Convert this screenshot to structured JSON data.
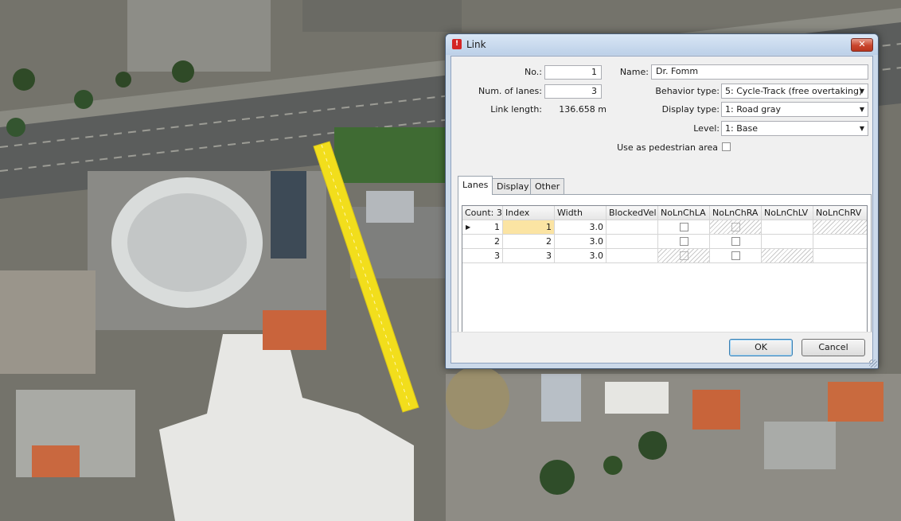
{
  "dialog": {
    "title": "Link",
    "close_glyph": "✕",
    "app_icon": "vissim-icon"
  },
  "form": {
    "no_label": "No.:",
    "no_value": "1",
    "lanes_label": "Num. of lanes:",
    "lanes_value": "3",
    "length_label": "Link length:",
    "length_value": "136.658 m",
    "name_label": "Name:",
    "name_value": "Dr. Fomm",
    "behavior_label": "Behavior type:",
    "behavior_value": "5: Cycle-Track (free overtaking)",
    "display_label": "Display type:",
    "display_value": "1: Road gray",
    "level_label": "Level:",
    "level_value": "1: Base",
    "pedestrian_label": "Use as pedestrian area",
    "pedestrian_checked": false
  },
  "tabs": [
    {
      "label": "Lanes",
      "active": true
    },
    {
      "label": "Display",
      "active": false
    },
    {
      "label": "Other",
      "active": false
    }
  ],
  "grid": {
    "columns": [
      "Count: 3",
      "Index",
      "Width",
      "BlockedVel",
      "NoLnChLA",
      "NoLnChRA",
      "NoLnChLV",
      "NoLnChRV"
    ],
    "rows": [
      {
        "count": "1",
        "index": "1",
        "width": "3.0",
        "current": true
      },
      {
        "count": "2",
        "index": "2",
        "width": "3.0",
        "current": false
      },
      {
        "count": "3",
        "index": "3",
        "width": "3.0",
        "current": false
      }
    ]
  },
  "buttons": {
    "ok": "OK",
    "cancel": "Cancel"
  },
  "colors": {
    "link_highlight": "#f2de1c",
    "selected_cell": "#fbe4a3"
  }
}
